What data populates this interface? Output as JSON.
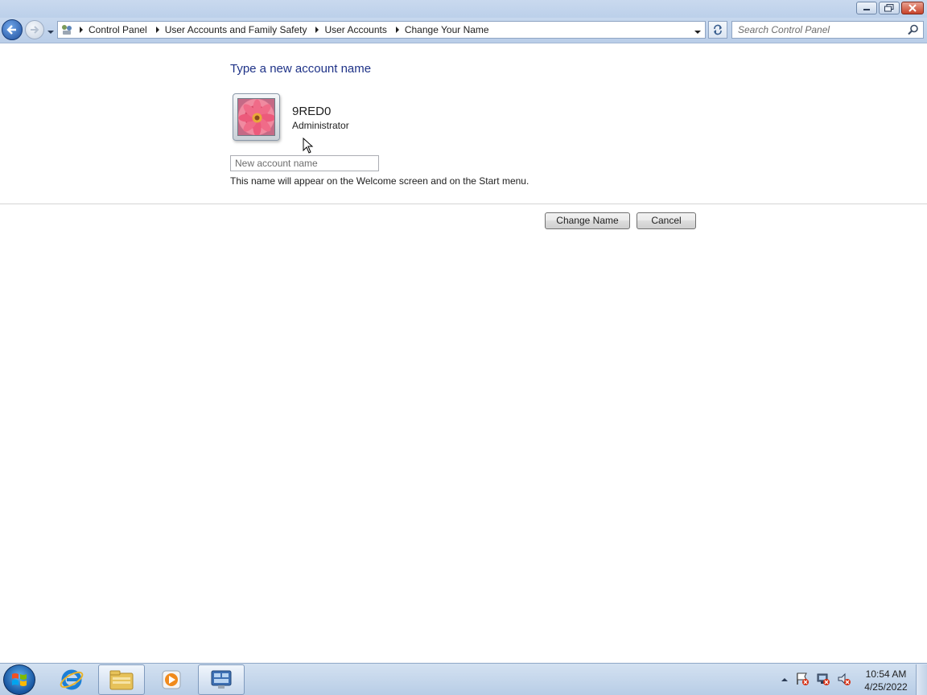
{
  "window": {
    "controls": [
      "minimize",
      "restore",
      "close"
    ]
  },
  "navigation": {
    "breadcrumb": [
      "Control Panel",
      "User Accounts and Family Safety",
      "User Accounts",
      "Change Your Name"
    ],
    "search_placeholder": "Search Control Panel"
  },
  "page": {
    "heading": "Type a new account name",
    "user": {
      "name": "9RED0",
      "role": "Administrator",
      "picture": "flower-picture"
    },
    "input_placeholder": "New account name",
    "input_value": "",
    "hint": "This name will appear on the Welcome screen and on the Start menu.",
    "buttons": {
      "change": "Change Name",
      "cancel": "Cancel"
    }
  },
  "taskbar": {
    "items": [
      "start-orb",
      "internet-explorer-icon",
      "windows-explorer-icon",
      "media-player-icon",
      "control-panel-icon"
    ],
    "active_item": "control-panel-icon",
    "tray_icons": [
      "show-hidden-icons",
      "action-center-flag-icon",
      "network-icon",
      "volume-muted-icon"
    ],
    "clock": {
      "time": "10:54 AM",
      "date": "4/25/2022"
    }
  },
  "colors": {
    "heading": "#1e3287",
    "chrome": "#bcd0ea",
    "background": "#ffffff"
  }
}
